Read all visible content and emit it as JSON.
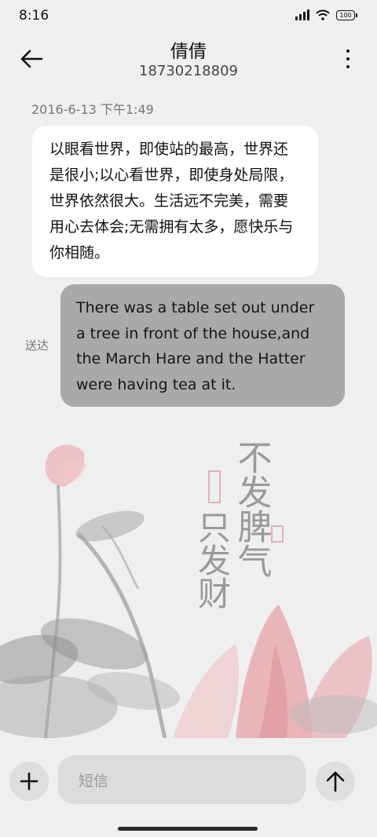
{
  "status_bar": {
    "time": "8:16",
    "battery": "100"
  },
  "header": {
    "contact_name": "倩倩",
    "phone_number": "18730218809"
  },
  "conversation": {
    "timestamp": "2016-6-13 下午1:49",
    "messages": [
      {
        "direction": "incoming",
        "text": "以眼看世界，即使站的最高，世界还是很小;以心看世界，即使身处局限，世界依然很大。生活远不完美，需要用心去体会;无需拥有太多，愿快乐与你相随。"
      },
      {
        "direction": "outgoing",
        "text": "There was a table set out under a tree in front of the house,and the March Hare and the Hatter were having tea at it.",
        "status": "送达"
      }
    ]
  },
  "background_art": {
    "calligraphy_line1": "不发脾气",
    "calligraphy_line2": "只发财"
  },
  "composer": {
    "placeholder": "短信"
  },
  "icons": {
    "back": "arrow-left-icon",
    "more": "more-vertical-icon",
    "add": "plus-icon",
    "send": "arrow-up-icon",
    "signal": "signal-icon",
    "wifi": "wifi-icon",
    "battery": "battery-icon"
  },
  "colors": {
    "background": "#efefef",
    "incoming_bubble": "#ffffff",
    "outgoing_bubble": "#a9a9a9",
    "lotus_pink": "#e8a4aa",
    "ink": "#8c8c8c"
  }
}
